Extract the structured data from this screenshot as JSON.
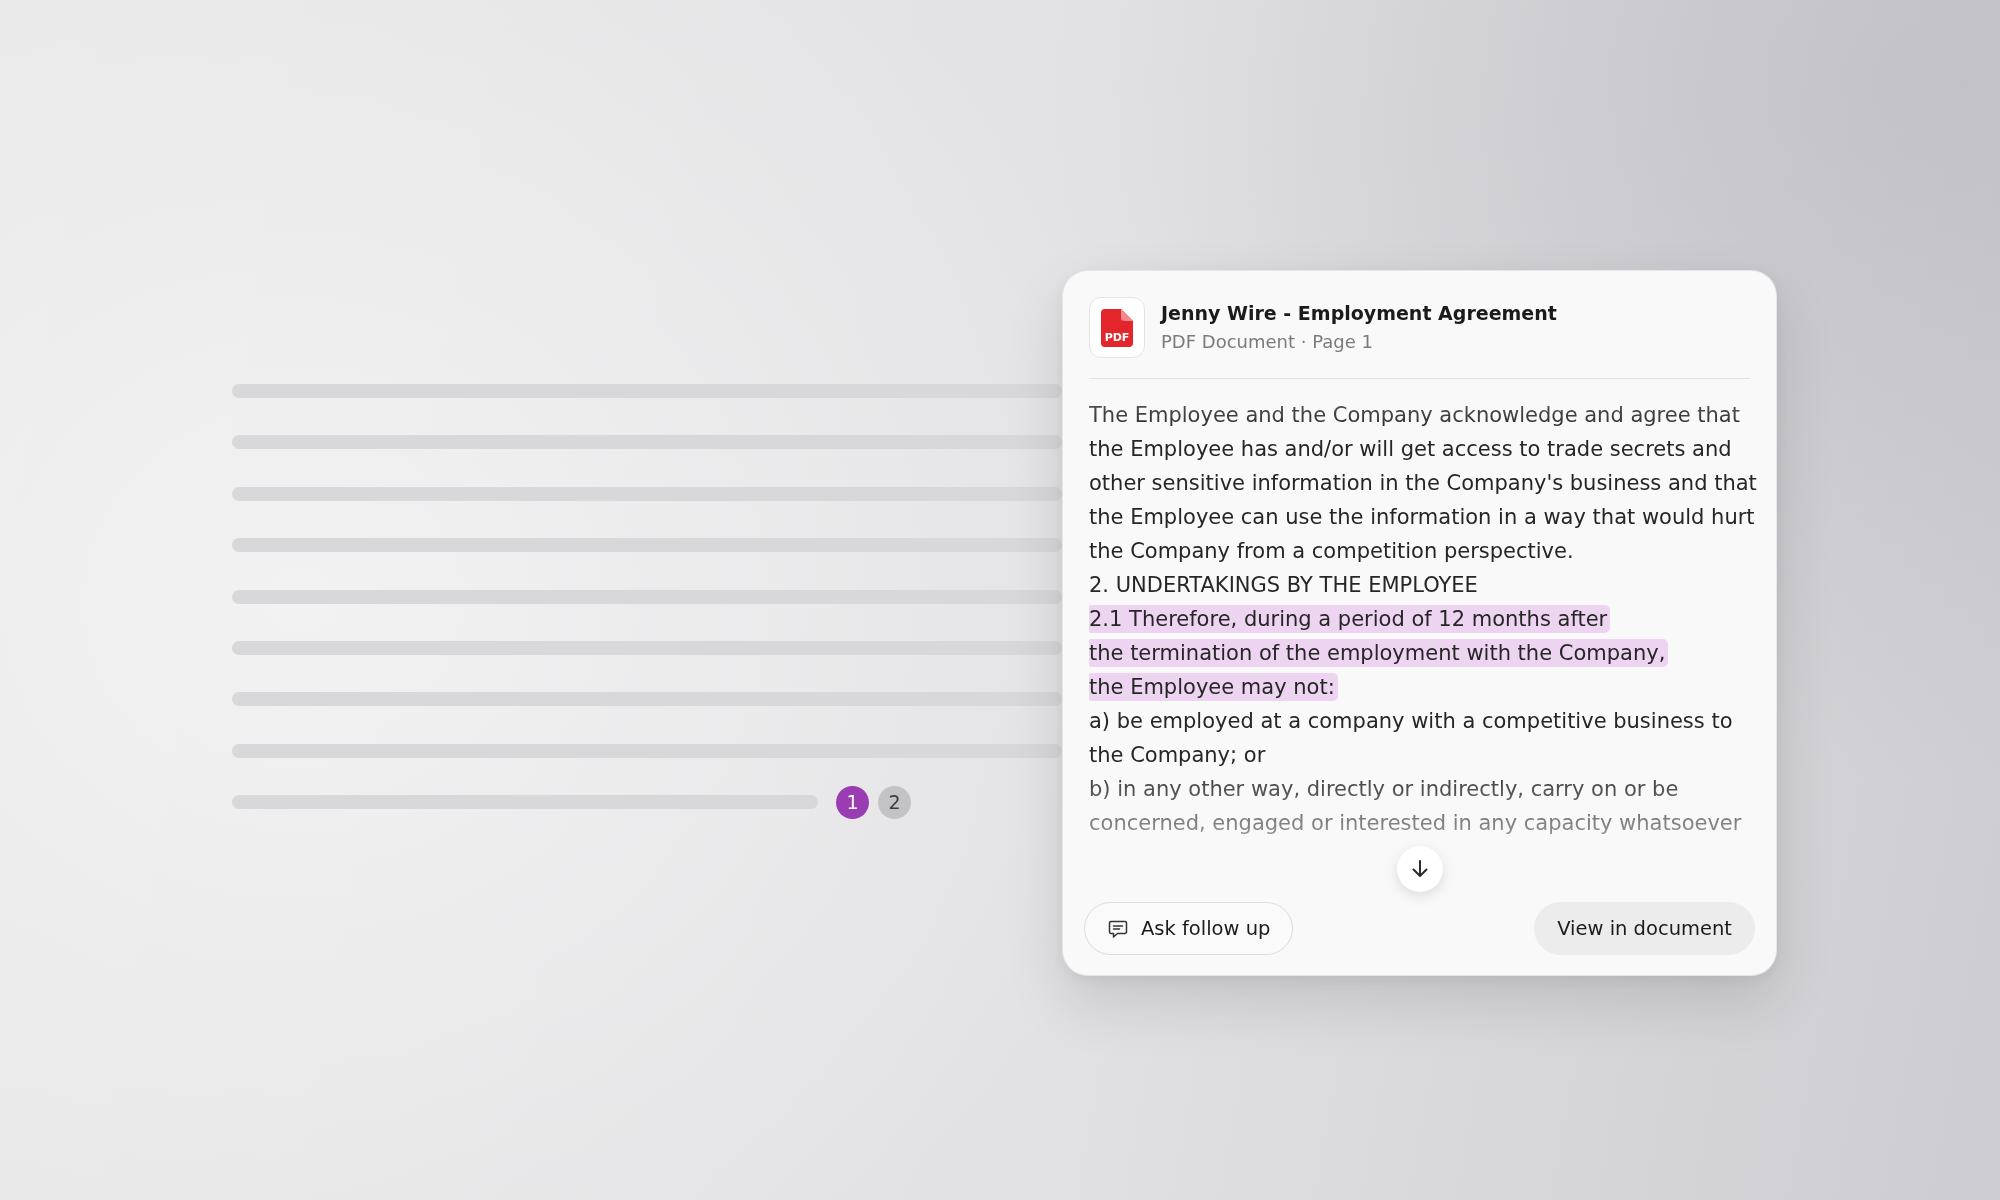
{
  "document_preview": {
    "citations": [
      {
        "label": "1",
        "selected": true
      },
      {
        "label": "2",
        "selected": false
      }
    ]
  },
  "source_card": {
    "file_icon_label": "PDF",
    "title": "Jenny Wire - Employment Agreement",
    "subtitle": "PDF Document · Page 1",
    "passage": [
      {
        "highlighted": false,
        "text": "The Employee and the Company acknowledge and agree that the Employee has and/or will get access to trade secrets and other sensitive information in the Company's business and that the Employee can use the information in a way that would hurt the Company from a competition perspective."
      },
      {
        "highlighted": false,
        "text": "2. UNDERTAKINGS BY THE EMPLOYEE"
      },
      {
        "highlighted": true,
        "lines": [
          "2.1 Therefore, during a period of 12 months after",
          "the termination of the employment with the Company,",
          "the Employee may not:"
        ]
      },
      {
        "highlighted": false,
        "text": "a) be employed at a company with a competitive business to the Company; or"
      },
      {
        "highlighted": false,
        "text": "b) in any other way, directly or indirectly, carry on or be concerned, engaged or interested in any capacity whatsoever"
      }
    ],
    "actions": [
      {
        "kind": "outline",
        "label": "Ask follow up"
      },
      {
        "kind": "filled",
        "label": "View in document"
      }
    ]
  }
}
